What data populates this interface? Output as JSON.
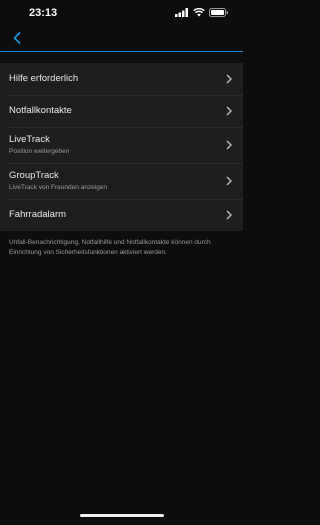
{
  "status_bar": {
    "time": "23:13"
  },
  "nav": {
    "back_label": ""
  },
  "items": [
    {
      "label": "Hilfe erforderlich",
      "sub": ""
    },
    {
      "label": "Notfallkontakte",
      "sub": ""
    },
    {
      "label": "LiveTrack",
      "sub": "Position weitergeben"
    },
    {
      "label": "GroupTrack",
      "sub": "LiveTrack von Freunden anzeigen"
    },
    {
      "label": "Fahrradalarm",
      "sub": ""
    }
  ],
  "footer": "Unfall-Benachrichtigung, Notfallhilfe und Notfallkontakte können durch Einrichtung von Sicherheitsfunktionen aktiviert werden.",
  "colors": {
    "accent": "#1c8fd6",
    "background": "#0d0d0d",
    "row_background": "#1e1e1e"
  },
  "icons": [
    "back-chevron-icon",
    "chevron-right-icon",
    "signal-icon",
    "wifi-icon",
    "battery-icon"
  ]
}
